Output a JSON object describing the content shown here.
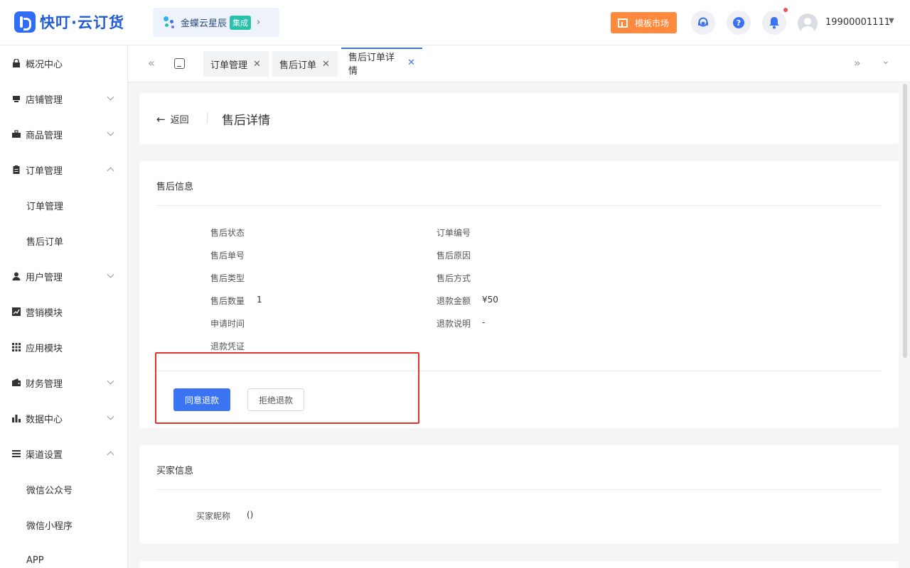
{
  "app": {
    "logo_text": "快叮·云订货",
    "kingdee_label": "金蝶云星辰",
    "kingdee_badge": "集成",
    "template_button": "模板市场",
    "user_name": "19900001111",
    "colors": {
      "brand": "#2f6df6",
      "accent_orange": "#ff8a3d",
      "primary": "#3b74f2",
      "highlight_red": "#e8312c"
    }
  },
  "sidebar": {
    "items": [
      {
        "label": "概况中心",
        "icon": "home-lock-icon"
      },
      {
        "label": "店铺管理",
        "icon": "store-icon"
      },
      {
        "label": "商品管理",
        "icon": "briefcase-icon"
      },
      {
        "label": "订单管理",
        "icon": "clipboard-icon"
      },
      {
        "label": "订单管理"
      },
      {
        "label": "售后订单"
      },
      {
        "label": "用户管理",
        "icon": "user-icon"
      },
      {
        "label": "营销模块",
        "icon": "chart-icon"
      },
      {
        "label": "应用模块",
        "icon": "grid-icon"
      },
      {
        "label": "财务管理",
        "icon": "wallet-icon"
      },
      {
        "label": "数据中心",
        "icon": "bar-chart-icon"
      },
      {
        "label": "渠道设置",
        "icon": "list-icon"
      },
      {
        "label": "微信公众号"
      },
      {
        "label": "微信小程序"
      },
      {
        "label": "APP"
      }
    ]
  },
  "tabs": [
    {
      "label": "订单管理"
    },
    {
      "label": "售后订单"
    },
    {
      "label": "售后订单详情"
    }
  ],
  "header": {
    "back_label": "返回",
    "title": "售后详情"
  },
  "aftersale": {
    "section_title": "售后信息",
    "left_fields": [
      {
        "label": "售后状态",
        "value": ""
      },
      {
        "label": "售后单号",
        "value": ""
      },
      {
        "label": "售后类型",
        "value": ""
      },
      {
        "label": "售后数量",
        "value": "1"
      },
      {
        "label": "申请时间",
        "value": ""
      },
      {
        "label": "退款凭证",
        "value": ""
      }
    ],
    "right_fields": [
      {
        "label": "订单编号",
        "value": ""
      },
      {
        "label": "售后原因",
        "value": ""
      },
      {
        "label": "售后方式",
        "value": ""
      },
      {
        "label": "退款金额",
        "value": "¥50"
      },
      {
        "label": "退款说明",
        "value": "-"
      }
    ],
    "agree_button": "同意退款",
    "reject_button": "拒绝退款"
  },
  "buyer": {
    "section_title": "买家信息",
    "nickname_label": "买家昵称",
    "nickname_value": "()"
  }
}
